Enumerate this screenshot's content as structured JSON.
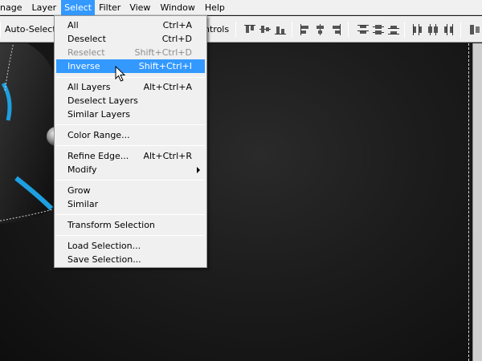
{
  "menubar": {
    "items": [
      "nage",
      "Layer",
      "Select",
      "Filter",
      "View",
      "Window",
      "Help"
    ]
  },
  "options": {
    "autoselect_label": "Auto-Select:",
    "controls_label": "ntrols"
  },
  "select_menu": {
    "groups": [
      [
        {
          "label": "All",
          "shortcut": "Ctrl+A",
          "enabled": true
        },
        {
          "label": "Deselect",
          "shortcut": "Ctrl+D",
          "enabled": true
        },
        {
          "label": "Reselect",
          "shortcut": "Shift+Ctrl+D",
          "enabled": false
        },
        {
          "label": "Inverse",
          "shortcut": "Shift+Ctrl+I",
          "enabled": true,
          "highlighted": true
        }
      ],
      [
        {
          "label": "All Layers",
          "shortcut": "Alt+Ctrl+A",
          "enabled": true
        },
        {
          "label": "Deselect Layers",
          "shortcut": "",
          "enabled": true
        },
        {
          "label": "Similar Layers",
          "shortcut": "",
          "enabled": true
        }
      ],
      [
        {
          "label": "Color Range...",
          "shortcut": "",
          "enabled": true
        }
      ],
      [
        {
          "label": "Refine Edge...",
          "shortcut": "Alt+Ctrl+R",
          "enabled": true
        },
        {
          "label": "Modify",
          "shortcut": "",
          "enabled": true,
          "submenu": true
        }
      ],
      [
        {
          "label": "Grow",
          "shortcut": "",
          "enabled": true
        },
        {
          "label": "Similar",
          "shortcut": "",
          "enabled": true
        }
      ],
      [
        {
          "label": "Transform Selection",
          "shortcut": "",
          "enabled": true
        }
      ],
      [
        {
          "label": "Load Selection...",
          "shortcut": "",
          "enabled": true
        },
        {
          "label": "Save Selection...",
          "shortcut": "",
          "enabled": true
        }
      ]
    ]
  },
  "colors": {
    "highlight": "#3399ff",
    "accent_blue": "#1e9fe0"
  }
}
